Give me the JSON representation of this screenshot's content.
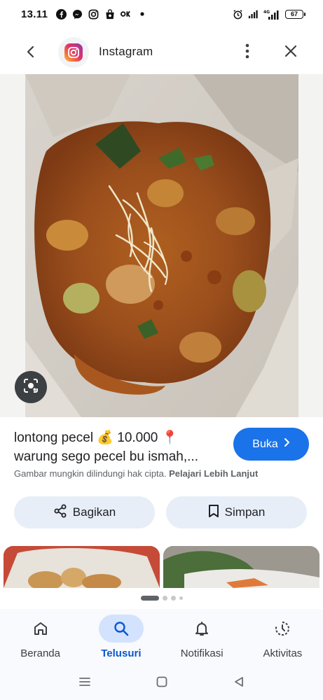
{
  "status_bar": {
    "time": "13.11",
    "battery": "67",
    "network": "4G",
    "left_icons": [
      "facebook-icon",
      "messenger-icon",
      "instagram-icon",
      "shop-icon",
      "app-icon",
      "dot-icon"
    ],
    "right_icons": [
      "alarm-icon",
      "signal-icon",
      "signal-4g-icon",
      "battery-icon"
    ]
  },
  "header": {
    "title": "Instagram",
    "back_icon": "arrow-left-icon",
    "more_icon": "more-vert-icon",
    "close_icon": "close-icon"
  },
  "image": {
    "lens_icon": "lens-search-icon"
  },
  "result": {
    "caption_line1": "lontong pecel 💰 10.000 📍",
    "caption_line2": "warung sego pecel bu ismah,...",
    "visit_label": "Buka",
    "copyright_text": "Gambar mungkin dilindungi hak cipta.",
    "copyright_link": "Pelajari Lebih Lanjut"
  },
  "actions": {
    "share_label": "Bagikan",
    "save_label": "Simpan"
  },
  "pager": {
    "active_index": 0,
    "count": 4
  },
  "bottom_nav": {
    "items": [
      {
        "label": "Beranda",
        "icon": "home-icon"
      },
      {
        "label": "Telusuri",
        "icon": "search-icon",
        "active": true
      },
      {
        "label": "Notifikasi",
        "icon": "bell-icon"
      },
      {
        "label": "Aktivitas",
        "icon": "activity-icon"
      }
    ]
  },
  "colors": {
    "accent": "#1a73e8",
    "nav_active": "#0b57d0",
    "nav_active_bg": "#d3e3fd",
    "pill_bg": "#e8eef8"
  }
}
